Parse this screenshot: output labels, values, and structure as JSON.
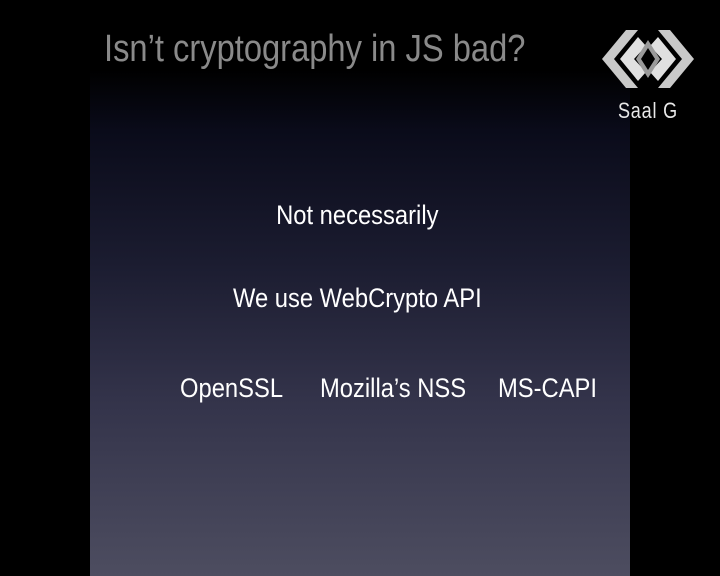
{
  "slide": {
    "title": "Isn’t cryptography in JS bad?",
    "answer": "Not necessarily",
    "statement": "We use WebCrypto API",
    "libraries": [
      "OpenSSL",
      "Mozilla’s NSS",
      "MS-CAPI"
    ]
  },
  "logo": {
    "text": "Saal G",
    "icon": "saal-g-logo-icon",
    "colors": {
      "primary": "#c9c9c9",
      "background": "#000000"
    }
  },
  "colors": {
    "background": "#000000",
    "title": "#8a8a8a",
    "body_text": "#ffffff",
    "panel_gradient_top": "#000000",
    "panel_gradient_bottom": "#4d4d60"
  }
}
